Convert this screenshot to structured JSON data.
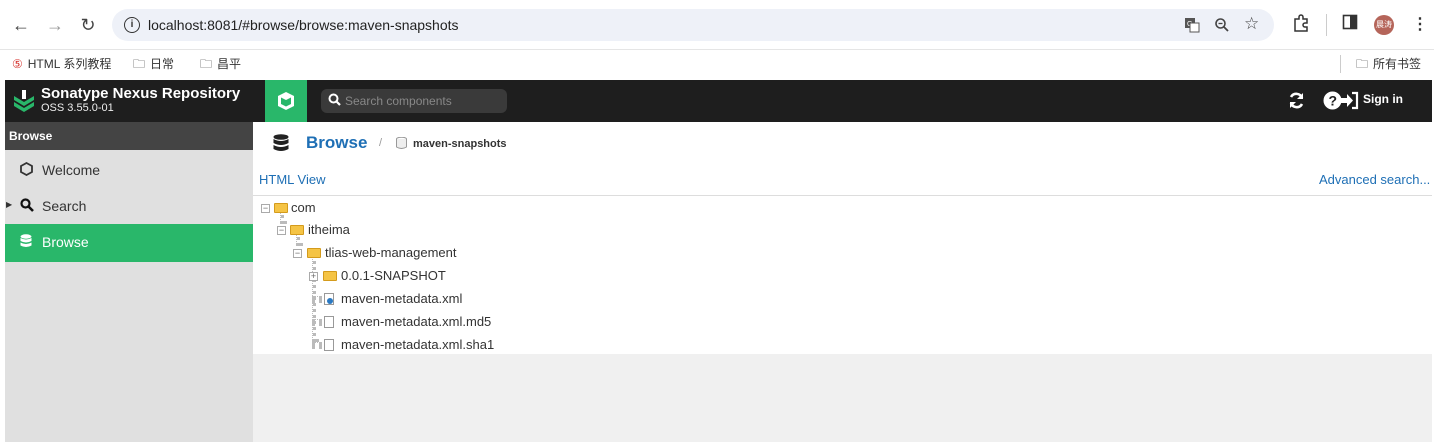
{
  "browser": {
    "url": "localhost:8081/#browse/browse:maven-snapshots",
    "profile_initials": "晨涛",
    "bookmarks": [
      "HTML 系列教程",
      "日常",
      "昌平"
    ],
    "all_bookmarks": "所有书签"
  },
  "header": {
    "title": "Sonatype Nexus Repository",
    "version": "OSS 3.55.0-01",
    "search_placeholder": "Search components",
    "signin": "Sign in"
  },
  "sidebar": {
    "heading": "Browse",
    "items": [
      {
        "label": "Welcome",
        "icon": "hexagon-icon"
      },
      {
        "label": "Search",
        "icon": "search-icon"
      },
      {
        "label": "Browse",
        "icon": "database-icon"
      }
    ]
  },
  "breadcrumb": {
    "main": "Browse",
    "separator": "/",
    "repo": "maven-snapshots"
  },
  "links": {
    "html_view": "HTML View",
    "advanced_search": "Advanced search..."
  },
  "tree": {
    "nodes": [
      {
        "label": "com",
        "type": "folder"
      },
      {
        "label": "itheima",
        "type": "folder"
      },
      {
        "label": "tlias-web-management",
        "type": "folder"
      },
      {
        "label": "0.0.1-SNAPSHOT",
        "type": "folder"
      },
      {
        "label": "maven-metadata.xml",
        "type": "xml-file"
      },
      {
        "label": "maven-metadata.xml.md5",
        "type": "file"
      },
      {
        "label": "maven-metadata.xml.sha1",
        "type": "file"
      }
    ]
  },
  "colors": {
    "accent_green": "#29b76a",
    "link_blue": "#1e6fb5",
    "header_bg": "#1e1e1e"
  }
}
